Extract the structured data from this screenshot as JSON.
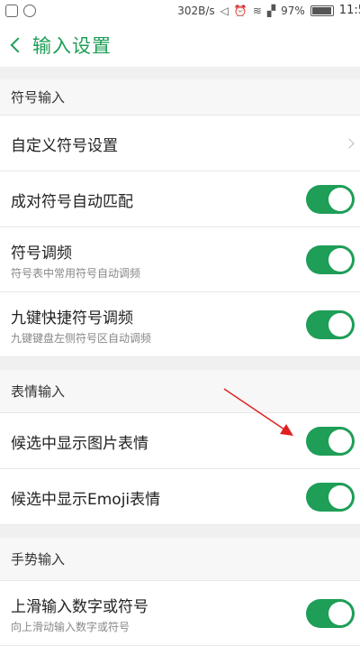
{
  "status_bar": {
    "network_speed": "302B/s",
    "battery_percent": "97%",
    "battery_level": 0.97,
    "time": "11:5",
    "icons": [
      "notification-icon",
      "notification-icon-2",
      "mute-icon",
      "alarm-icon",
      "wifi-icon",
      "signal-icon",
      "battery-icon"
    ]
  },
  "header": {
    "title": "输入设置",
    "back_icon": "chevron-left-icon"
  },
  "sections": {
    "symbols": {
      "header": "符号输入",
      "custom": {
        "title": "自定义符号设置"
      },
      "auto_match": {
        "title": "成对符号自动匹配",
        "enabled": true
      },
      "frequency": {
        "title": "符号调频",
        "subtitle": "符号表中常用符号自动调频",
        "enabled": true
      },
      "nine_key": {
        "title": "九键快捷符号调频",
        "subtitle": "九键键盘左侧符号区自动调频",
        "enabled": true
      }
    },
    "emoticons": {
      "header": "表情输入",
      "image_candidates": {
        "title": "候选中显示图片表情",
        "enabled": true
      },
      "emoji_candidates": {
        "title": "候选中显示Emoji表情",
        "enabled": true
      }
    },
    "gestures": {
      "header": "手势输入",
      "swipe_up": {
        "title": "上滑输入数字或符号",
        "subtitle": "向上滑动输入数字或符号",
        "enabled": true
      }
    }
  },
  "colors": {
    "accent": "#1e9e57",
    "annotation": "#e02020"
  }
}
